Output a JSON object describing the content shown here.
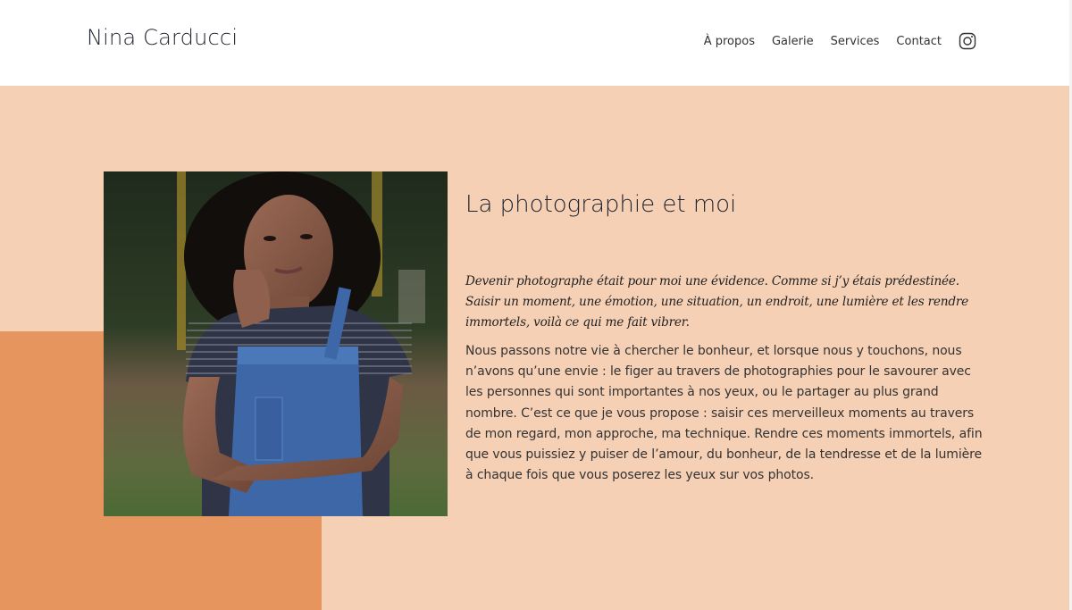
{
  "header": {
    "brand": "Nina Carducci",
    "nav": [
      {
        "label": "À propos"
      },
      {
        "label": "Galerie"
      },
      {
        "label": "Services"
      },
      {
        "label": "Contact"
      }
    ],
    "social_icon": "instagram-icon"
  },
  "about": {
    "title": "La photographie et moi",
    "quote": "Devenir photographe était pour moi une évidence. Comme si j’y étais prédestinée. Saisir un moment, une émotion, une situation, un endroit, une lumière et les rendre immortels, voilà ce qui me fait vibrer.",
    "body": "Nous passons notre vie à chercher le bonheur, et lorsque nous y touchons, nous n’avons qu’une envie : le figer au travers de photographies pour le savourer avec les personnes qui sont importantes à nos yeux, ou le partager au plus grand nombre. C’est ce que je vous propose : saisir ces merveilleux moments au travers de mon regard, mon approche, ma technique. Rendre ces moments immortels, afin que vous puissiez y puiser de l’amour, du bonheur, de la tendresse et de la lumière à chaque fois que vous poserez les yeux sur vos photos.",
    "photo_alt": "Portrait of a woman with curly hair in a striped t-shirt and denim overalls"
  },
  "colors": {
    "peach": "#F5D0B5",
    "orange": "#E6955F",
    "text": "#1f2330"
  }
}
